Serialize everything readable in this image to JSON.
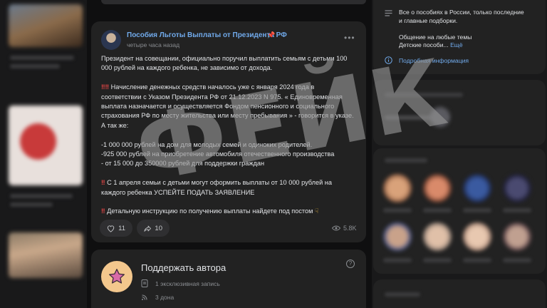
{
  "post": {
    "author": "Пособия Льготы Выплаты от Президента РФ",
    "time": "четыре часа назад",
    "paragraphs": [
      [
        "Президент на совещании, официально поручил выплатить семьям с детьми 100",
        "000 рублей на каждого ребенка, не зависимо от дохода."
      ],
      [
        "Начисление денежных средств началось уже с января 2024 года в",
        "соответствии с Указом Президента РФ от 21.12.2023 N 975. « Единовременная",
        "выплата назначается и осуществляется Фондом пенсионного и социального",
        "страхования РФ по месту жительства или месту пребывания » - говорится в указе.",
        "А так же:"
      ],
      [
        "-1 000 000 рублей на дом для молодых семей и одиноких родителей.",
        "-925 000 рублей на приобретение автомобиля отечественного производства",
        "- от 15 000 до 350000 рублей для поддержки граждан"
      ],
      [
        "С 1 апреля семьи с детьми могут оформить выплаты от 10 000 рублей на",
        "каждого ребенка УСПЕЙТЕ ПОДАТЬ ЗАЯВЛЕНИЕ"
      ],
      [
        "Детальную инструкцию по получению выплаты найдете под постом"
      ]
    ],
    "likes": "11",
    "shares": "10",
    "views": "5.8K"
  },
  "support": {
    "title": "Поддержать автора",
    "exclusive": "1 эксклюзивная запись",
    "donations": "3 дона"
  },
  "info": {
    "line1": "Все о пособиях в России, только последние",
    "line2": "и главные подборки.",
    "line3": "Общение на любые темы",
    "line4": "Детские пособи...",
    "more": "Ещё",
    "link": "Подробная информация"
  },
  "watermark": "ФЕЙК",
  "colors": {
    "accent": "#71aaeb",
    "card": "#222222",
    "background": "#0f0f10"
  }
}
